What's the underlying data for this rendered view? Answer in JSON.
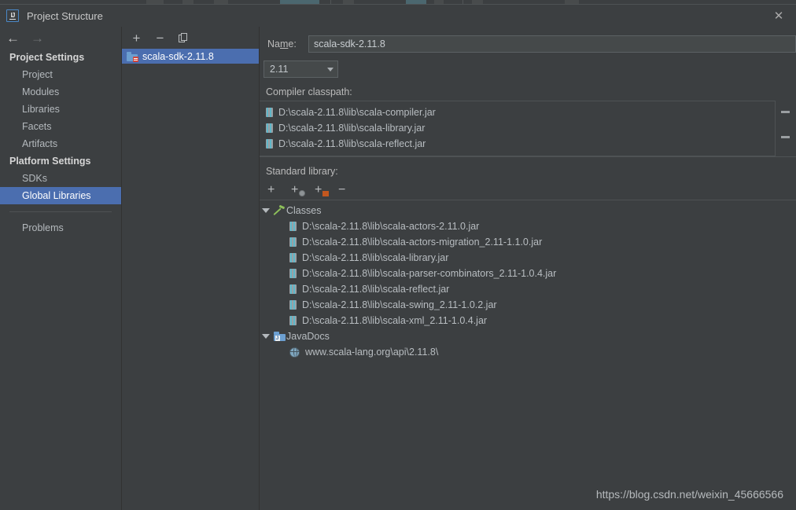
{
  "window": {
    "title": "Project Structure",
    "app_icon": "intellij-idea-icon",
    "close_label": "✕"
  },
  "nav": {
    "back_arrow": "←",
    "forward_arrow": "→",
    "groups": [
      {
        "title": "Project Settings",
        "items": [
          {
            "label": "Project",
            "selected": false
          },
          {
            "label": "Modules",
            "selected": false
          },
          {
            "label": "Libraries",
            "selected": false
          },
          {
            "label": "Facets",
            "selected": false
          },
          {
            "label": "Artifacts",
            "selected": false
          }
        ]
      },
      {
        "title": "Platform Settings",
        "items": [
          {
            "label": "SDKs",
            "selected": false
          },
          {
            "label": "Global Libraries",
            "selected": true
          }
        ]
      }
    ],
    "footer_items": [
      {
        "label": "Problems",
        "selected": false
      }
    ]
  },
  "midpanel": {
    "toolbar": {
      "add_label": "+",
      "remove_label": "−",
      "copy_label": "copy"
    },
    "items": [
      {
        "label": "scala-sdk-2.11.8",
        "selected": true
      }
    ]
  },
  "detail": {
    "name_label_pre": "Na",
    "name_label_mnemonic": "m",
    "name_label_post": "e:",
    "name_value": "scala-sdk-2.11.8",
    "name_placeholder": "",
    "language_level": "2.11",
    "compiler_classpath_label": "Compiler classpath:",
    "compiler_classpath": [
      "D:\\scala-2.11.8\\lib\\scala-compiler.jar",
      "D:\\scala-2.11.8\\lib\\scala-library.jar",
      "D:\\scala-2.11.8\\lib\\scala-reflect.jar"
    ],
    "standard_library_label": "Standard library:",
    "std_toolbar": {
      "add_label": "+",
      "add_javadoc_url_label": "+",
      "add_attachment_label": "+",
      "remove_label": "−"
    },
    "tree": [
      {
        "label": "Classes",
        "icon": "hammer-icon",
        "expanded": true,
        "twisty": "▼",
        "children": [
          "D:\\scala-2.11.8\\lib\\scala-actors-2.11.0.jar",
          "D:\\scala-2.11.8\\lib\\scala-actors-migration_2.11-1.1.0.jar",
          "D:\\scala-2.11.8\\lib\\scala-library.jar",
          "D:\\scala-2.11.8\\lib\\scala-parser-combinators_2.11-1.0.4.jar",
          "D:\\scala-2.11.8\\lib\\scala-reflect.jar",
          "D:\\scala-2.11.8\\lib\\scala-swing_2.11-1.0.2.jar",
          "D:\\scala-2.11.8\\lib\\scala-xml_2.11-1.0.4.jar"
        ]
      },
      {
        "label": "JavaDocs",
        "icon": "javadoc-folder-icon",
        "expanded": true,
        "twisty": "▼",
        "children": [
          "www.scala-lang.org\\api\\2.11.8\\"
        ]
      }
    ]
  },
  "watermark": "https://blog.csdn.net/weixin_45666566",
  "colors": {
    "background": "#3c3f41",
    "selection": "#4b6eaf",
    "text": "#bbbbbb",
    "border": "#4e5254",
    "folder_blue": "#6c9fd0",
    "hammer_green": "#8dbf5a",
    "badge_red": "#d0453b",
    "accent_orange": "#c2571f"
  }
}
